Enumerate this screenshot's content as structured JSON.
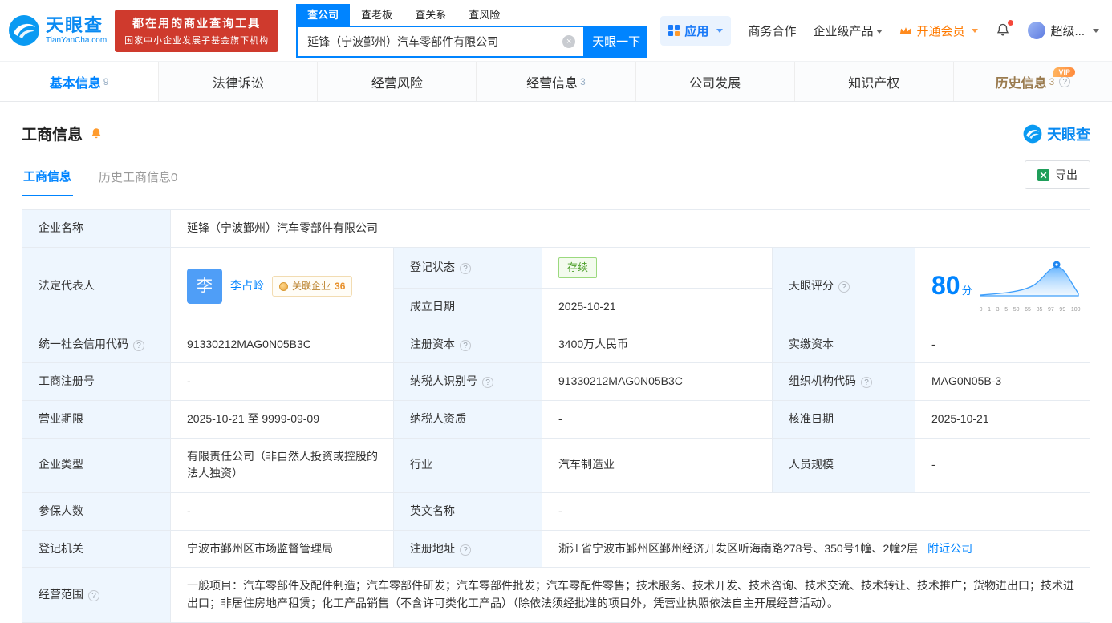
{
  "colors": {
    "brand_blue": "#0084ff",
    "promo_red": "#cf3a2d",
    "membership_orange": "#ff7a00",
    "status_green": "#4ea02c",
    "history_gold": "#9a7b4f",
    "label_cell_bg": "#eef6fe"
  },
  "brand": {
    "name_cn": "天眼查",
    "name_en": "TianYanCha.com"
  },
  "promo": {
    "line1": "都在用的商业查询工具",
    "line2": "国家中小企业发展子基金旗下机构"
  },
  "search": {
    "tabs": [
      {
        "label": "查公司"
      },
      {
        "label": "查老板"
      },
      {
        "label": "查关系"
      },
      {
        "label": "查风险"
      }
    ],
    "value": "延锋（宁波鄞州）汽车零部件有限公司",
    "button": "天眼一下"
  },
  "topnav": {
    "apps": "应用",
    "coop": "商务合作",
    "enterprise": "企业级产品",
    "vip": "开通会员",
    "user": "超级..."
  },
  "tabs": [
    {
      "label": "基本信息",
      "count": "9"
    },
    {
      "label": "法律诉讼",
      "count": ""
    },
    {
      "label": "经营风险",
      "count": ""
    },
    {
      "label": "经营信息",
      "count": "3"
    },
    {
      "label": "公司发展",
      "count": ""
    },
    {
      "label": "知识产权",
      "count": ""
    },
    {
      "label": "历史信息",
      "count": "3",
      "vip": "VIP"
    }
  ],
  "section": {
    "title": "工商信息",
    "brand": "天眼查",
    "subtab_main": "工商信息",
    "subtab_history": "历史工商信息",
    "subtab_history_count": "0",
    "export": "导出"
  },
  "info": {
    "company_name": {
      "label": "企业名称",
      "value": "延锋（宁波鄞州）汽车零部件有限公司"
    },
    "legal_rep": {
      "label": "法定代表人",
      "avatar": "李",
      "name": "李占岭",
      "related_label": "关联企业",
      "related_count": "36"
    },
    "reg_status": {
      "label": "登记状态",
      "value": "存续"
    },
    "est_date": {
      "label": "成立日期",
      "value": "2025-10-21"
    },
    "score": {
      "label": "天眼评分",
      "value": "80",
      "unit": "分",
      "axis": [
        "0",
        "1",
        "3",
        "5",
        "50",
        "65",
        "85",
        "97",
        "99",
        "100"
      ]
    },
    "credit_code": {
      "label": "统一社会信用代码",
      "value": "91330212MAG0N05B3C"
    },
    "reg_capital": {
      "label": "注册资本",
      "value": "3400万人民币"
    },
    "paid_capital": {
      "label": "实缴资本",
      "value": "-"
    },
    "reg_no": {
      "label": "工商注册号",
      "value": "-"
    },
    "taxpayer_id": {
      "label": "纳税人识别号",
      "value": "91330212MAG0N05B3C"
    },
    "org_code": {
      "label": "组织机构代码",
      "value": "MAG0N05B-3"
    },
    "term": {
      "label": "营业期限",
      "value": "2025-10-21 至 9999-09-09"
    },
    "taxpayer_quality": {
      "label": "纳税人资质",
      "value": "-"
    },
    "approval_date": {
      "label": "核准日期",
      "value": "2025-10-21"
    },
    "company_type": {
      "label": "企业类型",
      "value": "有限责任公司（非自然人投资或控股的法人独资）"
    },
    "industry": {
      "label": "行业",
      "value": "汽车制造业"
    },
    "staff_size": {
      "label": "人员规模",
      "value": "-"
    },
    "insured": {
      "label": "参保人数",
      "value": "-"
    },
    "english_name": {
      "label": "英文名称",
      "value": "-"
    },
    "authority": {
      "label": "登记机关",
      "value": "宁波市鄞州区市场监督管理局"
    },
    "address": {
      "label": "注册地址",
      "value": "浙江省宁波市鄞州区鄞州经济开发区听海南路278号、350号1幢、2幢2层",
      "link": "附近公司"
    },
    "scope": {
      "label": "经营范围",
      "value": "一般项目：汽车零部件及配件制造；汽车零部件研发；汽车零部件批发；汽车零配件零售；技术服务、技术开发、技术咨询、技术交流、技术转让、技术推广；货物进出口；技术进出口；非居住房地产租赁；化工产品销售（不含许可类化工产品）（除依法须经批准的项目外，凭营业执照依法自主开展经营活动）。"
    }
  }
}
